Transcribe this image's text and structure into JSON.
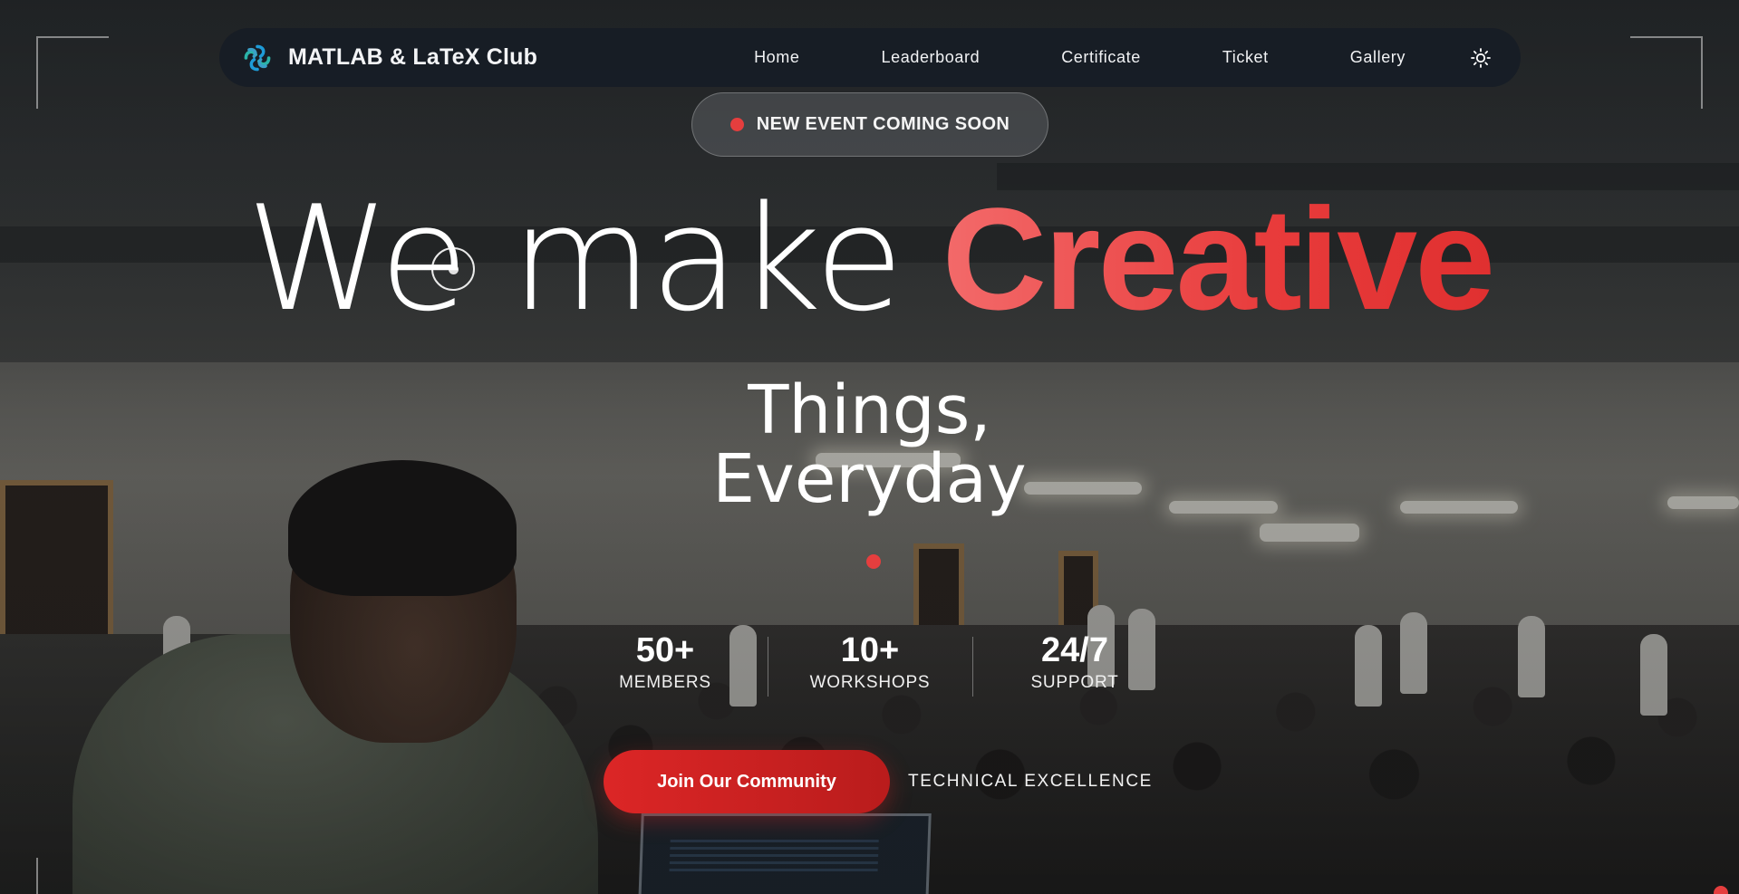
{
  "brand": {
    "name": "MATLAB & LaTeX Club",
    "logo_icon": "atom-knot-logo-icon"
  },
  "nav": {
    "links": [
      "Home",
      "Leaderboard",
      "Certificate",
      "Ticket",
      "Gallery"
    ],
    "theme_toggle_icon": "sun-icon"
  },
  "announcement": {
    "text": "NEW EVENT COMING SOON",
    "dot_color": "#e53e3e"
  },
  "hero": {
    "line1_light": "We make",
    "line1_bold": "Creative",
    "line2": "Things,",
    "line3": "Everyday",
    "accent_color": "#e83b3b"
  },
  "stats": [
    {
      "value": "50+",
      "label": "MEMBERS"
    },
    {
      "value": "10+",
      "label": "WORKSHOPS"
    },
    {
      "value": "24/7",
      "label": "SUPPORT"
    }
  ],
  "cta": {
    "button_label": "Join Our Community",
    "tagline": "TECHNICAL EXCELLENCE",
    "button_color": "#dc2626"
  }
}
